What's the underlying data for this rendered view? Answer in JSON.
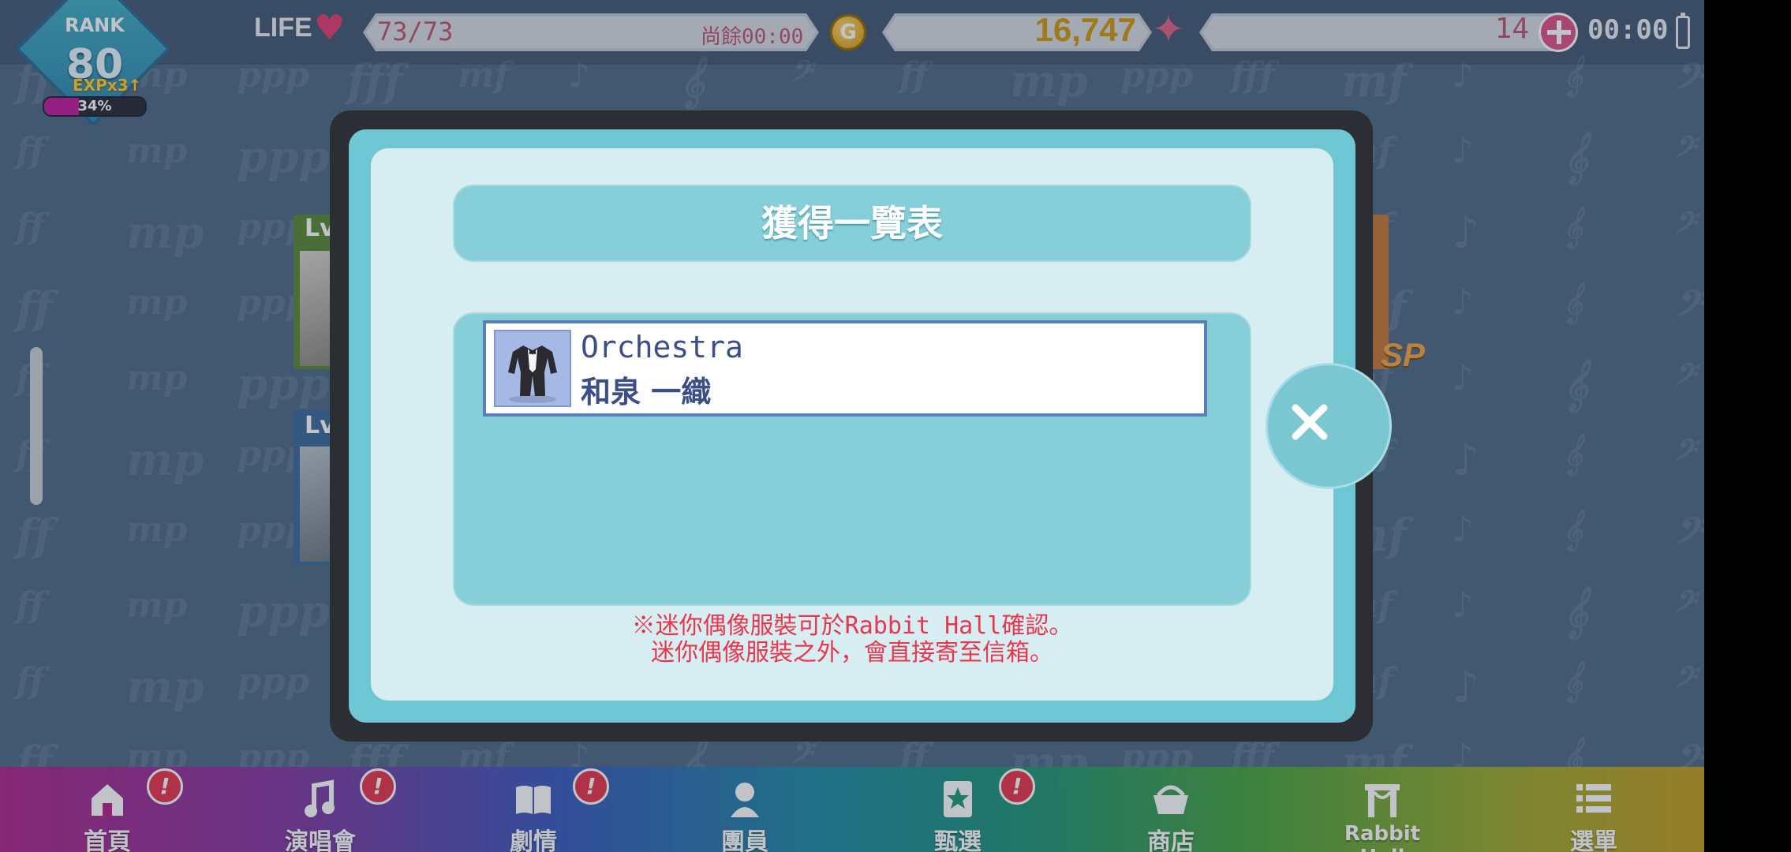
{
  "status_bar": {
    "rank_label": "RANK",
    "rank_value": "80",
    "exp_boost": "EXPx3↑",
    "exp_percent": "34%",
    "exp_progress": 0.34,
    "life_label": "LIFE",
    "life_value": "73/73",
    "life_recover_time": "尚餘00:00",
    "gold_icon_letter": "G",
    "gold_value": "16,747",
    "gem_value": "14",
    "clock": "00:00"
  },
  "background_cards": {
    "card1_level": "Lv.",
    "card2_level": "Lv.",
    "rarity_badge": "R SP"
  },
  "modal": {
    "title": "獲得一覽表",
    "items": [
      {
        "name": "Orchestra",
        "owner": "和泉 一織",
        "icon": "tuxedo-costume-icon"
      }
    ],
    "note_line1": "※迷你偶像服裝可於Rabbit Hall確認。",
    "note_line2": "迷你偶像服裝之外，會直接寄至信箱。",
    "close_icon": "close-icon"
  },
  "bottom_nav": [
    {
      "label": "首頁",
      "icon": "home-icon",
      "alert": "!"
    },
    {
      "label": "演唱會",
      "icon": "music-note-icon",
      "alert": "!"
    },
    {
      "label": "劇情",
      "icon": "book-icon",
      "alert": "!"
    },
    {
      "label": "團員",
      "icon": "member-icon"
    },
    {
      "label": "甄選",
      "icon": "star-card-icon",
      "alert": "!"
    },
    {
      "label": "商店",
      "icon": "shop-basket-icon"
    },
    {
      "label": "Rabbit Hall",
      "icon": "rabbit-hall-icon"
    },
    {
      "label": "選單",
      "icon": "menu-list-icon"
    }
  ],
  "colors": {
    "background": "#516a87",
    "modal_teal": "#6ec7d3",
    "modal_light": "#d6eef1",
    "note_red": "#e8364f",
    "gold": "#d29a12",
    "life_heart": "#e53f74"
  }
}
